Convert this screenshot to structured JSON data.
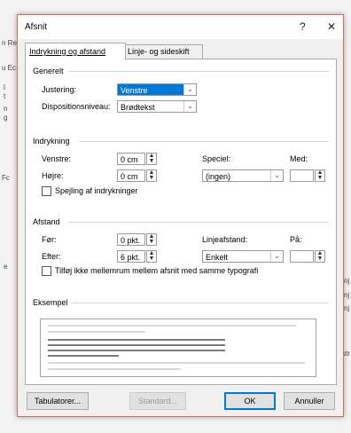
{
  "background": {
    "left_fragments": [
      "n Re",
      "u Ec",
      "l",
      "t",
      "n",
      "g",
      "Fc",
      "e"
    ],
    "right_fragments": [
      "nj",
      "nj",
      "nj",
      "str"
    ]
  },
  "dialog": {
    "title": "Afsnit",
    "help_label": "?",
    "close_label": "✕",
    "tabs": [
      {
        "label": "Indrykning og afstand",
        "active": true
      },
      {
        "label": "Linje- og sideskift",
        "active": false
      }
    ],
    "general": {
      "heading": "Generelt",
      "alignment_label": "Justering:",
      "alignment_value": "Venstre",
      "outline_label": "Dispositionsniveau:",
      "outline_value": "Brødtekst"
    },
    "indentation": {
      "heading": "Indrykning",
      "left_label": "Venstre:",
      "left_value": "0 cm",
      "right_label": "Højre:",
      "right_value": "0 cm",
      "special_label": "Speciel:",
      "special_value": "(ingen)",
      "by_label": "Med:",
      "by_value": "",
      "mirror_label": "Spejling af indrykninger"
    },
    "spacing": {
      "heading": "Afstand",
      "before_label": "Før:",
      "before_value": "0 pkt.",
      "after_label": "Efter:",
      "after_value": "6 pkt.",
      "line_spacing_label": "Linjeafstand:",
      "line_spacing_value": "Enkelt",
      "at_label": "På:",
      "at_value": "",
      "no_space_label": "Tilføj ikke mellemrum mellem afsnit med samme typografi"
    },
    "preview": {
      "heading": "Eksempel"
    },
    "buttons": {
      "tabs": "Tabulatorer...",
      "default": "Standard...",
      "ok": "OK",
      "cancel": "Annuller"
    }
  }
}
